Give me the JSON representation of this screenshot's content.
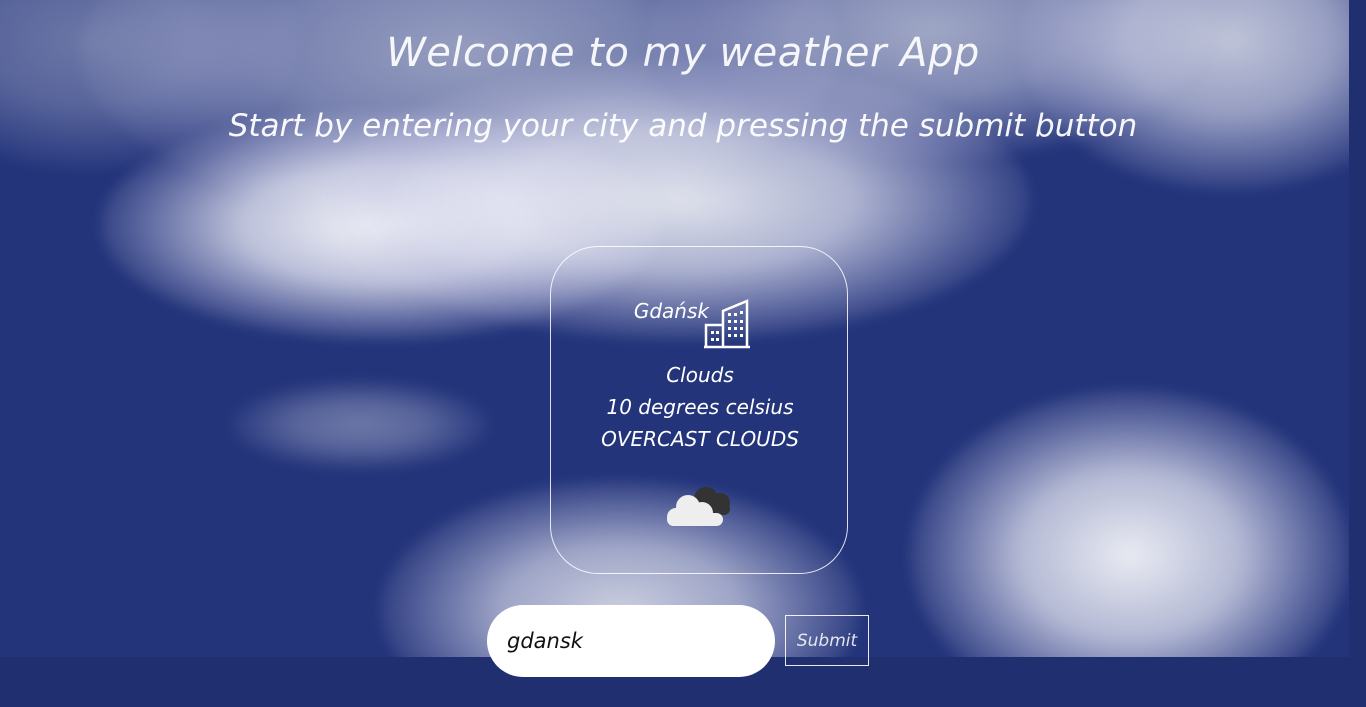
{
  "header": {
    "title": "Welcome to my weather App",
    "subtitle": "Start by entering your city and pressing the submit button"
  },
  "weather_card": {
    "city": "Gdańsk",
    "city_icon": "building-icon",
    "main": "Clouds",
    "temperature": "10 degrees celsius",
    "description": "OVERCAST CLOUDS",
    "weather_icon": "overcast-clouds-icon"
  },
  "search": {
    "value": "gdansk",
    "submit_label": "Submit"
  },
  "colors": {
    "background": "#1f2f70",
    "sky": "#23347a",
    "text": "#ffffff",
    "input_background": "#ffffff"
  }
}
